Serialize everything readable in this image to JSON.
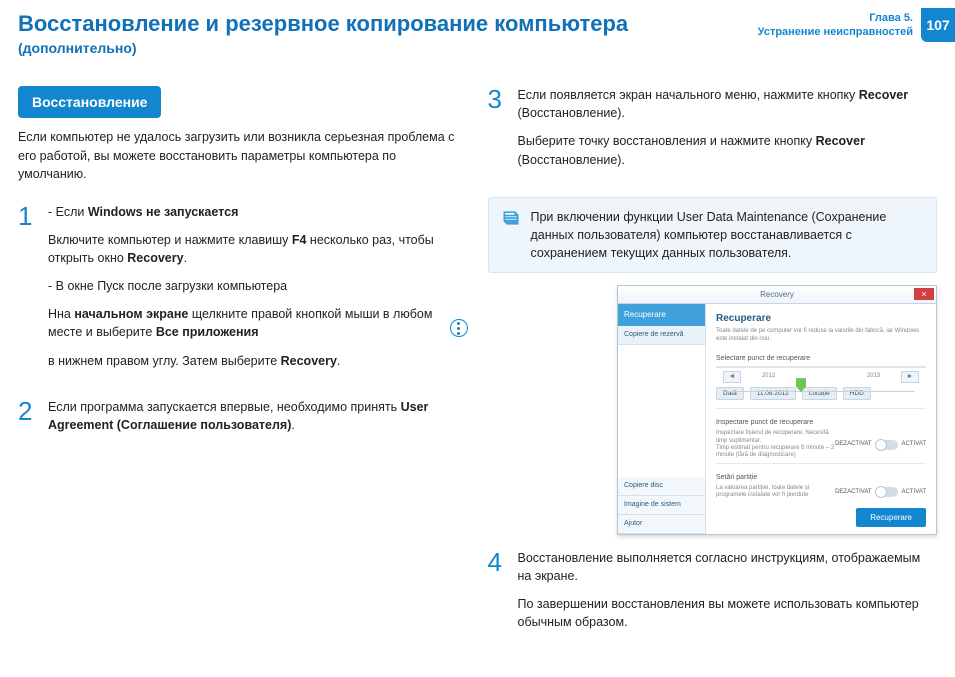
{
  "header": {
    "title": "Восстановление и резервное копирование компьютера",
    "subtitle": "(дополнительно)",
    "chapter_line1": "Глава 5.",
    "chapter_line2": "Устранение неисправностей",
    "page_number": "107"
  },
  "left": {
    "pill": "Восстановление",
    "intro": "Если компьютер не удалось загрузить или возникла серьезная проблема с его работой, вы можете восстановить параметры компьютера по умолчанию.",
    "step1": {
      "num": "1",
      "b1_prefix": "Если ",
      "b1_bold": "Windows не запускается",
      "p1_a": "Включите компьютер и нажмите клавишу ",
      "p1_key": "F4",
      "p1_b": " несколько раз, чтобы открыть окно ",
      "p1_bold": "Recovery",
      "p1_c": ".",
      "b2": "В окне Пуск после загрузки компьютера",
      "p2_a": "Нна ",
      "p2_bold1": "начальном экране",
      "p2_b": " щелкните правой кнопкой мыши в любом месте и выберите ",
      "p2_bold2": "Все приложения",
      "p3_a": "в нижнем правом углу. Затем выберите ",
      "p3_bold": "Recovery",
      "p3_b": "."
    },
    "step2": {
      "num": "2",
      "p_a": "Если программа запускается впервые, необходимо принять ",
      "p_bold": "User Agreement (Соглашение пользователя)",
      "p_b": "."
    }
  },
  "right": {
    "step3": {
      "num": "3",
      "p1_a": "Если появляется экран начального меню, нажмите кнопку ",
      "p1_bold": "Recover",
      "p1_b": " (Восстановление).",
      "p2_a": "Выберите точку восстановления и нажмите кнопку ",
      "p2_bold": "Recover",
      "p2_b": " (Восстановление)."
    },
    "note": "При включении функции User Data Maintenance (Сохранение данных пользователя) компьютер восстанавливается с сохранением текущих данных пользователя.",
    "screenshot": {
      "window_title": "Recovery",
      "close": "×",
      "side_head": "Recuperare",
      "side_item1": "Copiere de rezervă",
      "side_b1": "Copiere disc",
      "side_b2": "Imagine de sistem",
      "side_b3": "Ajutor",
      "main_title": "Recuperare",
      "main_sub": "Toate datele de pe computer vor fi reduse la valorile din fabrică, iar Windows este instalat din nou.",
      "sec1": "Selectare punct de recuperare",
      "year1": "2012",
      "year2": "2013",
      "chip_date_label": "Dată",
      "chip_date": "11.08.2012",
      "chip_loc_label": "Locație",
      "chip_loc": "HDD",
      "sec2": "Inspectare punct de recuperare",
      "desc1": "Inspectare fișierul de recuperare. Necesită timp suplimentar.",
      "desc1b": "Timp estimat pentru recuperare 5 minute – 2 minute (fără de diagnosticare)",
      "sec3": "Setări partiție",
      "desc2": "La valoarea partiției, toate datele și programele instalate vor fi pierdute",
      "tog_off": "DEZACTIVAT",
      "tog_on": "ACTIVAT",
      "button": "Recuperare"
    },
    "step4": {
      "num": "4",
      "p1": "Восстановление выполняется согласно инструкциям, отображаемым на экране.",
      "p2": "По завершении восстановления вы можете использовать компьютер обычным образом."
    }
  }
}
